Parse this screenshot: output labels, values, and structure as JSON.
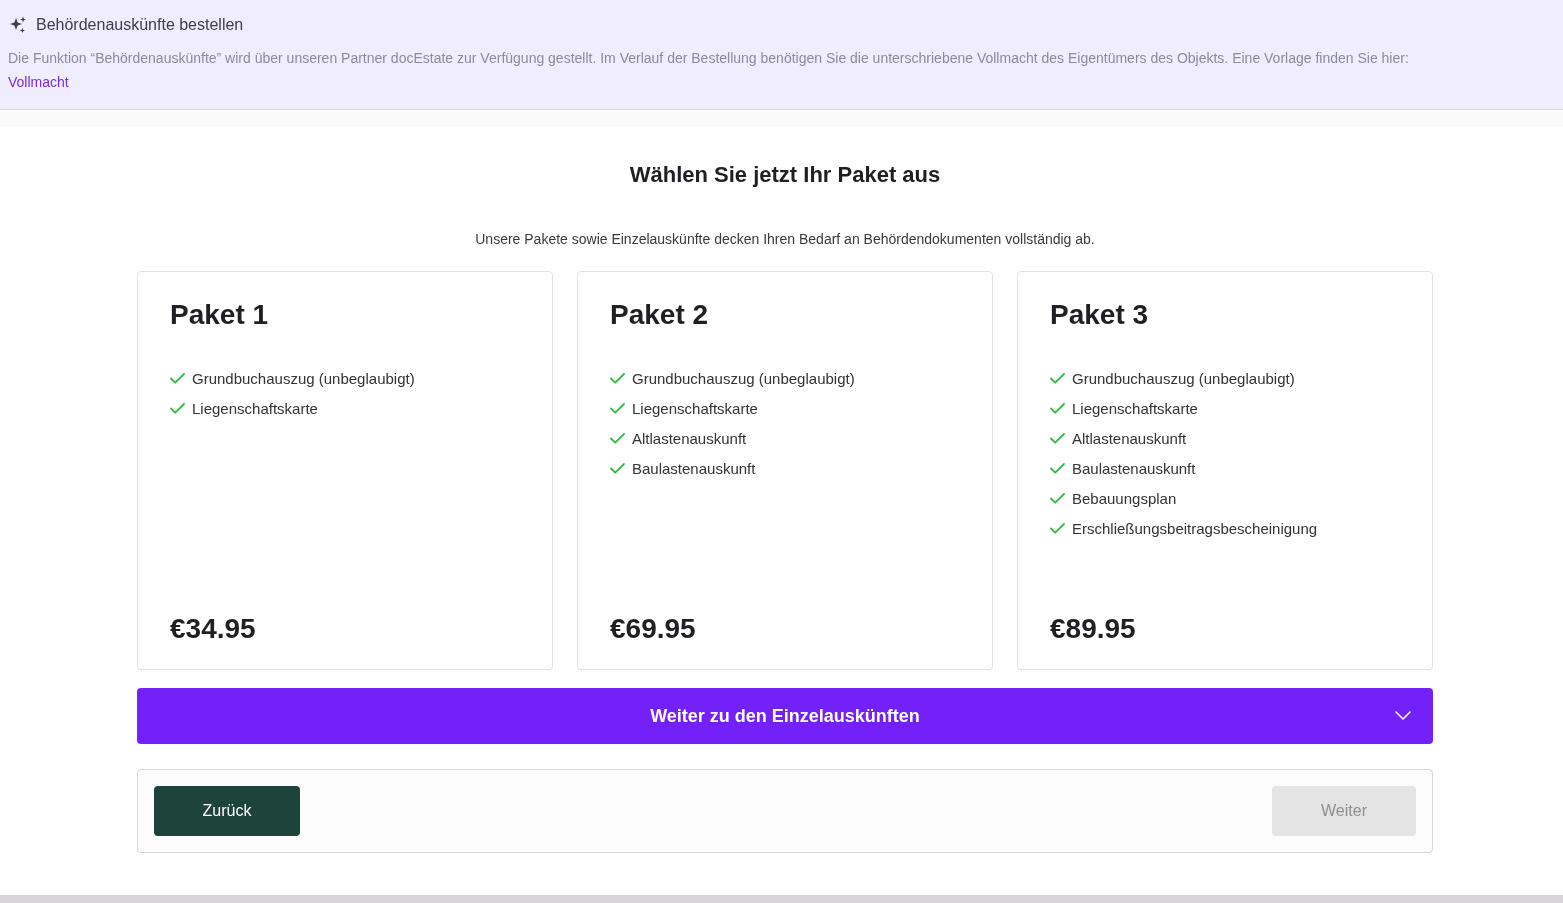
{
  "banner": {
    "title": "Behördenauskünfte bestellen",
    "text": "Die Funktion “Behördenauskünfte” wird über unseren Partner docEstate zur Verfügung gestellt. Im Verlauf der Bestellung benötigen Sie die unterschriebene Vollmacht des Eigentümers des Objekts. Eine Vorlage finden Sie hier:",
    "link": "Vollmacht"
  },
  "heading": "Wählen Sie jetzt Ihr Paket aus",
  "subtitle": "Unsere Pakete sowie Einzelauskünfte decken Ihren Bedarf an Behördendokumenten vollständig ab.",
  "packages": [
    {
      "name": "Paket 1",
      "features": [
        "Grundbuchauszug (unbeglaubigt)",
        "Liegenschaftskarte"
      ],
      "price": "€34.95"
    },
    {
      "name": "Paket 2",
      "features": [
        "Grundbuchauszug (unbeglaubigt)",
        "Liegenschaftskarte",
        "Altlastenauskunft",
        "Baulastenauskunft"
      ],
      "price": "€69.95"
    },
    {
      "name": "Paket 3",
      "features": [
        "Grundbuchauszug (unbeglaubigt)",
        "Liegenschaftskarte",
        "Altlastenauskunft",
        "Baulastenauskunft",
        "Bebauungsplan",
        "Erschließungsbeitragsbescheinigung"
      ],
      "price": "€89.95"
    }
  ],
  "accordion": {
    "label": "Weiter zu den Einzelauskünften",
    "expanded": false
  },
  "footer": {
    "back": {
      "label": "Zurück",
      "disabled": false
    },
    "next": {
      "label": "Weiter",
      "disabled": true
    }
  }
}
